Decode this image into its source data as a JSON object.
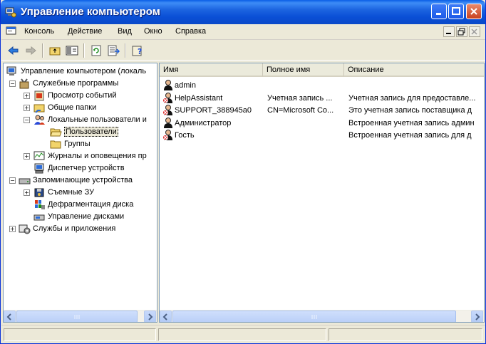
{
  "window": {
    "title": "Управление компьютером"
  },
  "menu": {
    "items": [
      {
        "label": "Консоль",
        "name": "menu-console"
      },
      {
        "label": "Действие",
        "name": "menu-action"
      },
      {
        "label": "Вид",
        "name": "menu-view"
      },
      {
        "label": "Окно",
        "name": "menu-window"
      },
      {
        "label": "Справка",
        "name": "menu-help"
      }
    ]
  },
  "toolbar": {
    "icons": [
      "back-arrow-icon",
      "forward-arrow-icon",
      "up-folder-icon",
      "show-hide-tree-icon",
      "refresh-icon",
      "export-list-icon",
      "properties-help-icon"
    ]
  },
  "tree": {
    "root": "Управление компьютером (локаль",
    "items": [
      {
        "label": "Служебные программы",
        "icon": "tools-icon"
      },
      {
        "label": "Просмотр событий",
        "icon": "event-viewer-icon"
      },
      {
        "label": "Общие папки",
        "icon": "shared-folders-icon"
      },
      {
        "label": "Локальные пользователи и",
        "icon": "local-users-icon"
      },
      {
        "label": "Пользователи",
        "icon": "folder-open-icon"
      },
      {
        "label": "Группы",
        "icon": "folder-icon"
      },
      {
        "label": "Журналы и оповещения пр",
        "icon": "logs-alerts-icon"
      },
      {
        "label": "Диспетчер устройств",
        "icon": "device-manager-icon"
      },
      {
        "label": "Запоминающие устройства",
        "icon": "storage-icon"
      },
      {
        "label": "Съемные ЗУ",
        "icon": "removable-storage-icon"
      },
      {
        "label": "Дефрагментация диска",
        "icon": "defrag-icon"
      },
      {
        "label": "Управление дисками",
        "icon": "disk-management-icon"
      },
      {
        "label": "Службы и приложения",
        "icon": "services-apps-icon"
      }
    ]
  },
  "list": {
    "columns": [
      "Имя",
      "Полное имя",
      "Описание"
    ],
    "rows": [
      {
        "name": "admin",
        "full_name": "",
        "description": "",
        "disabled": false
      },
      {
        "name": "HelpAssistant",
        "full_name": "Учетная запись ...",
        "description": "Учетная запись для предоставле...",
        "disabled": true
      },
      {
        "name": "SUPPORT_388945a0",
        "full_name": "CN=Microsoft Co...",
        "description": "Это учетная запись поставщика д",
        "disabled": true
      },
      {
        "name": "Администратор",
        "full_name": "",
        "description": "Встроенная учетная запись админ",
        "disabled": false
      },
      {
        "name": "Гость",
        "full_name": "",
        "description": "Встроенная учетная запись для д",
        "disabled": true
      }
    ]
  },
  "colors": {
    "titlebar": "#0a4fd6",
    "selection_bg": "#ece9d8",
    "pane_border": "#7f9db9"
  }
}
